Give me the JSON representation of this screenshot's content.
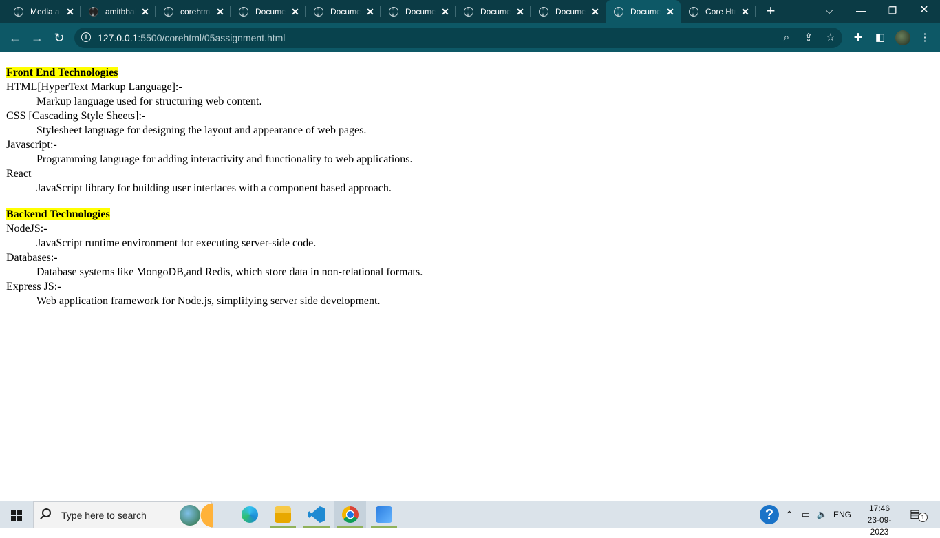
{
  "browser": {
    "tabs": [
      {
        "title": "Media and",
        "active": false
      },
      {
        "title": "amitbhai",
        "active": false
      },
      {
        "title": "corehtml",
        "active": false
      },
      {
        "title": "Document",
        "active": false
      },
      {
        "title": "Document",
        "active": false
      },
      {
        "title": "Document",
        "active": false
      },
      {
        "title": "Document",
        "active": false
      },
      {
        "title": "Document",
        "active": false
      },
      {
        "title": "Document",
        "active": true
      },
      {
        "title": "Core Html",
        "active": false
      }
    ],
    "new_tab_label": "+",
    "url_host": "127.0.0.1",
    "url_path": ":5500/corehtml/05assignment.html"
  },
  "page": {
    "front_end": {
      "heading": "Front End Technologies",
      "items": [
        {
          "term": "HTML[HyperText Markup Language]:-",
          "desc": "Markup language used for structuring web content."
        },
        {
          "term": "CSS [Cascading Style Sheets]:-",
          "desc": "Stylesheet language for designing the layout and appearance of web pages."
        },
        {
          "term": "Javascript:-",
          "desc": "Programming language for adding interactivity and functionality to web applications."
        },
        {
          "term": "React",
          "desc": "JavaScript library for building user interfaces with a component based approach."
        }
      ]
    },
    "back_end": {
      "heading": "Backend Technologies",
      "items": [
        {
          "term": "NodeJS:-",
          "desc": "JavaScript runtime environment for executing server-side code."
        },
        {
          "term": "Databases:-",
          "desc": "Database systems like MongoDB,and Redis, which store data in non-relational formats."
        },
        {
          "term": "Express JS:-",
          "desc": "Web application framework for Node.js, simplifying server side development."
        }
      ]
    }
  },
  "taskbar": {
    "search_placeholder": "Type here to search",
    "language": "ENG",
    "time": "17:46",
    "date": "23-09-2023",
    "notification_count": "1"
  },
  "colors": {
    "highlight": "#ffff00",
    "browser_frame": "#0b3b45",
    "toolbar": "#0d5866"
  }
}
